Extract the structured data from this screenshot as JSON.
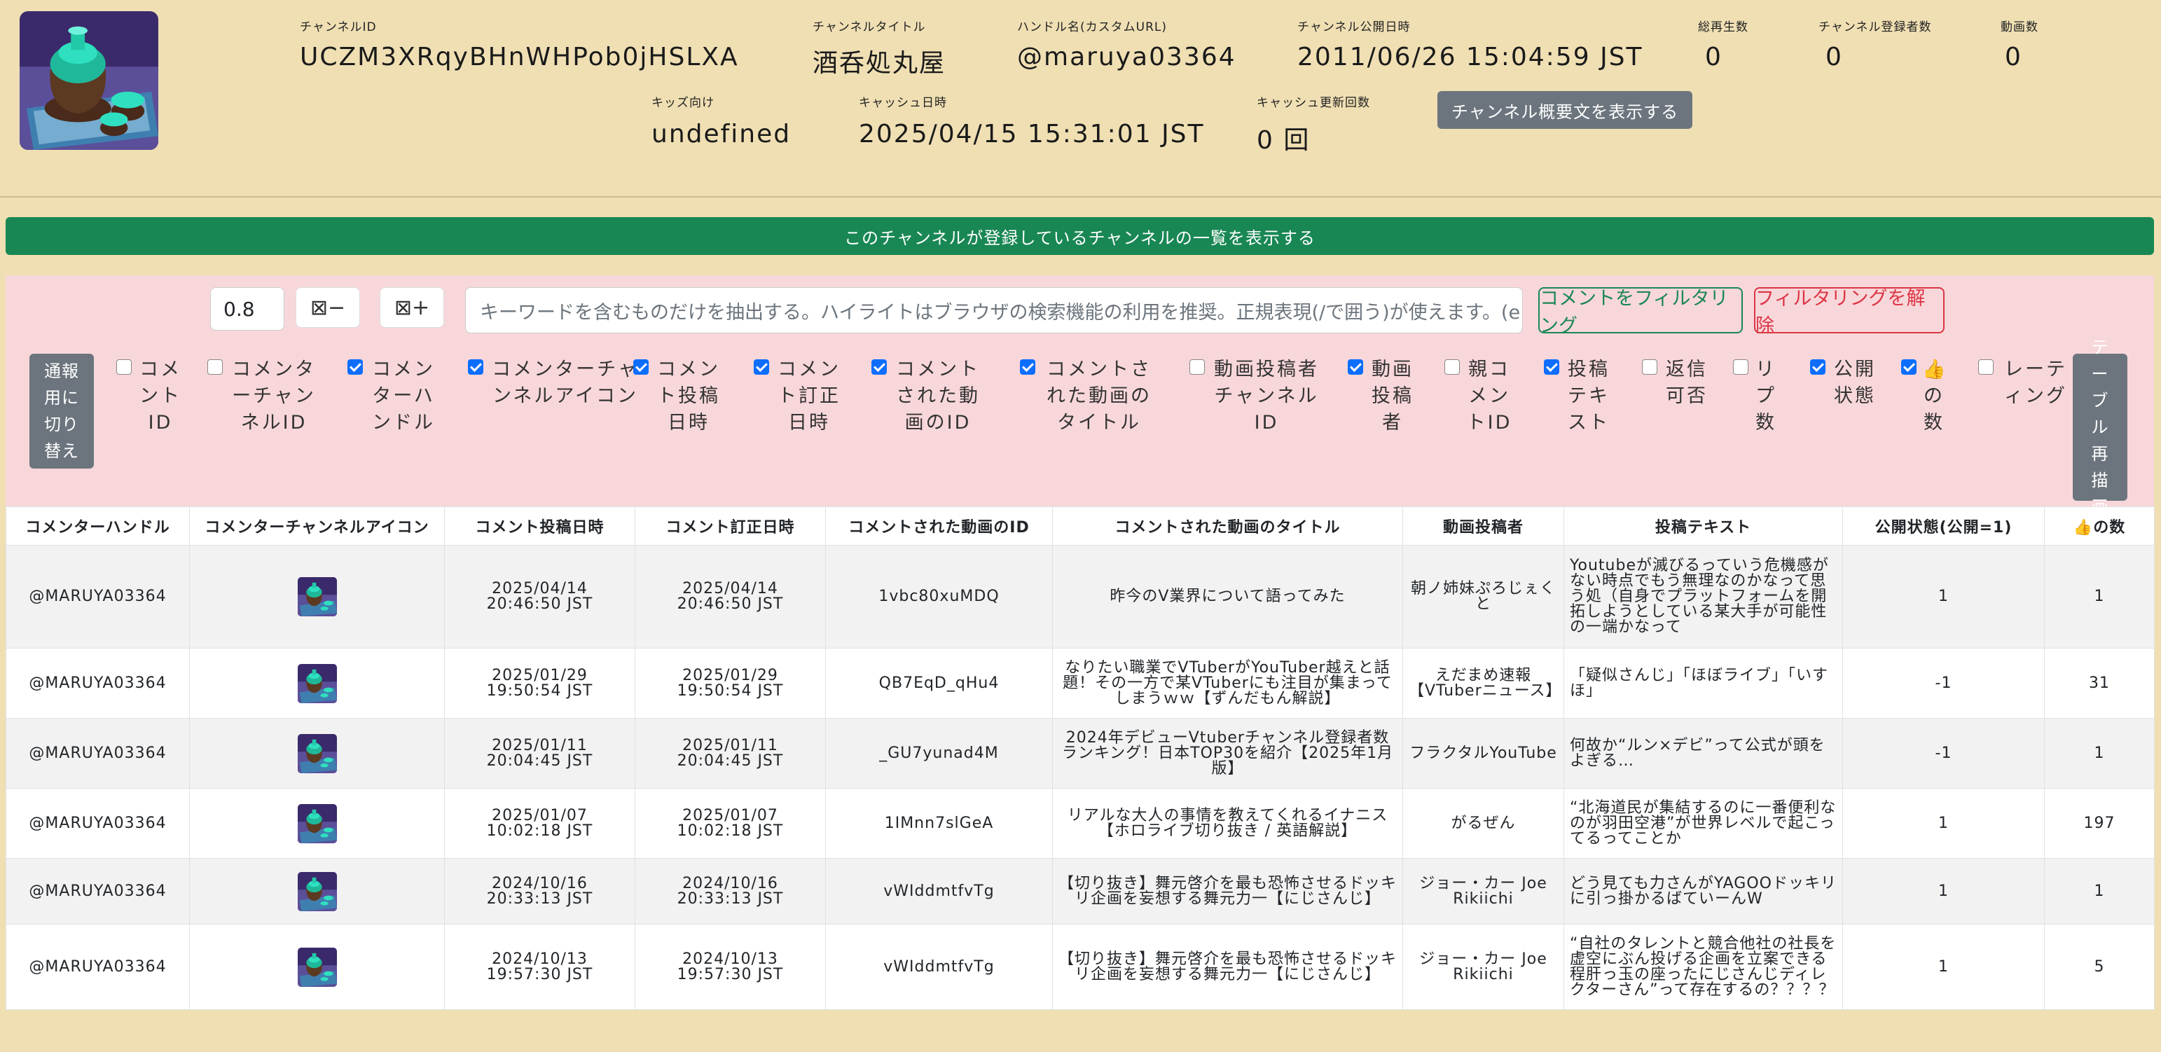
{
  "header": {
    "channel_id_label": "チャンネルID",
    "channel_id": "UCZM3XRqyBHnWHPob0jHSLXA",
    "channel_title_label": "チャンネルタイトル",
    "channel_title": "酒呑処丸屋",
    "handle_label": "ハンドル名(カスタムURL)",
    "handle": "@maruya03364",
    "published_label": "チャンネル公開日時",
    "published": "2011/06/26 15:04:59 JST",
    "total_views_label": "総再生数",
    "total_views": "0",
    "subscribers_label": "チャンネル登録者数",
    "subscribers": "0",
    "videos_label": "動画数",
    "videos": "0",
    "kids_label": "キッズ向け",
    "kids": "undefined",
    "cache_date_label": "キャッシュ日時",
    "cache_date": "2025/04/15 15:31:01 JST",
    "cache_count_label": "キャッシュ更新回数",
    "cache_count": "0 回",
    "show_desc_button": "チャンネル概要文を表示する"
  },
  "subscriptions_button": "このチャンネルが登録しているチャンネルの一覧を表示する",
  "filter": {
    "threshold_value": "0.8",
    "minus_label": "⊠−",
    "plus_label": "⊠+",
    "keyword_placeholder": "キーワードを含むものだけを抽出する。ハイライトはブラウザの検索機能の利用を推奨。正規表現(/で囲う)が使えます。(e.g. /(BC|AD",
    "filter_button": "コメントをフィルタリング",
    "clear_button": "フィルタリングを解除",
    "mode_button": "通報用に切り替え",
    "redraw_button": "テーブル再描画",
    "columns": [
      {
        "label": "コメントID",
        "checked": false
      },
      {
        "label": "コメンターチャンネルID",
        "checked": false
      },
      {
        "label": "コメンターハンドル",
        "checked": true
      },
      {
        "label": "コメンターチャンネルアイコン",
        "checked": true
      },
      {
        "label": "コメント投稿日時",
        "checked": true
      },
      {
        "label": "コメント訂正日時",
        "checked": true
      },
      {
        "label": "コメントされた動画のID",
        "checked": true
      },
      {
        "label": "コメントされた動画のタイトル",
        "checked": true
      },
      {
        "label": "動画投稿者チャンネルID",
        "checked": false
      },
      {
        "label": "動画投稿者",
        "checked": true
      },
      {
        "label": "親コメントID",
        "checked": false
      },
      {
        "label": "投稿テキスト",
        "checked": true
      },
      {
        "label": "返信可否",
        "checked": false
      },
      {
        "label": "リプ数",
        "checked": false
      },
      {
        "label": "公開状態",
        "checked": true
      },
      {
        "label": "👍の数",
        "checked": true
      },
      {
        "label": "レーティング",
        "checked": false
      }
    ]
  },
  "table": {
    "headers": [
      "コメンターハンドル",
      "コメンターチャンネルアイコン",
      "コメント投稿日時",
      "コメント訂正日時",
      "コメントされた動画のID",
      "コメントされた動画のタイトル",
      "動画投稿者",
      "投稿テキスト",
      "公開状態(公開=1)",
      "👍の数"
    ],
    "rows": [
      {
        "handle": "@MARUYA03364",
        "posted": "2025/04/14\n20:46:50 JST",
        "edited": "2025/04/14\n20:46:50 JST",
        "video_id": "1vbc80xuMDQ",
        "video_title": "昨今のV業界について語ってみた",
        "uploader": "朝ノ姉妹ぷろじぇくと",
        "text": "Youtubeが滅びるっていう危機感がない時点でもう無理なのかなって思う処（自身でプラットフォームを開拓しようとしている某大手が可能性の一端かなって",
        "status": "1",
        "likes": "1"
      },
      {
        "handle": "@MARUYA03364",
        "posted": "2025/01/29\n19:50:54 JST",
        "edited": "2025/01/29\n19:50:54 JST",
        "video_id": "QB7EqD_qHu4",
        "video_title": "なりたい職業でVTuberがYouTuber越えと話題！その一方で某VTuberにも注目が集まってしまうｗｗ【ずんだもん解説】",
        "uploader": "えだまめ速報【VTuberニュース】",
        "text": "「疑似さんじ」「ほぼライブ」「いすほ」",
        "status": "-1",
        "likes": "31"
      },
      {
        "handle": "@MARUYA03364",
        "posted": "2025/01/11\n20:04:45 JST",
        "edited": "2025/01/11\n20:04:45 JST",
        "video_id": "_GU7yunad4M",
        "video_title": "2024年デビューVtuberチャンネル登録者数ランキング！日本TOP30を紹介【2025年1月版】",
        "uploader": "フラクタルYouTube",
        "text": "何故か“ルン×デビ”って公式が頭をよぎる…",
        "status": "-1",
        "likes": "1"
      },
      {
        "handle": "@MARUYA03364",
        "posted": "2025/01/07\n10:02:18 JST",
        "edited": "2025/01/07\n10:02:18 JST",
        "video_id": "1IMnn7slGeA",
        "video_title": "リアルな大人の事情を教えてくれるイナニス【ホロライブ切り抜き / 英語解説】",
        "uploader": "がるぜん",
        "text": "“北海道民が集結するのに一番便利なのが羽田空港”が世界レベルで起こってるってことか",
        "status": "1",
        "likes": "197"
      },
      {
        "handle": "@MARUYA03364",
        "posted": "2024/10/16\n20:33:13 JST",
        "edited": "2024/10/16\n20:33:13 JST",
        "video_id": "vWIddmtfvTg",
        "video_title": "【切り抜き】舞元啓介を最も恐怖させるドッキリ企画を妄想する舞元力一【にじさんじ】",
        "uploader": "ジョー・カー Joe Rikiichi",
        "text": "どう見ても力さんがYAGOOドッキリに引っ掛かるばていーんW",
        "status": "1",
        "likes": "1"
      },
      {
        "handle": "@MARUYA03364",
        "posted": "2024/10/13\n19:57:30 JST",
        "edited": "2024/10/13\n19:57:30 JST",
        "video_id": "vWIddmtfvTg",
        "video_title": "【切り抜き】舞元啓介を最も恐怖させるドッキリ企画を妄想する舞元力一【にじさんじ】",
        "uploader": "ジョー・カー Joe Rikiichi",
        "text": "“自社のタレントと競合他社の社長を虚空にぶん投げる企画を立案できる程肝っ玉の座ったにじさんじディレクターさん”って存在するの？？？？",
        "status": "1",
        "likes": "5"
      }
    ]
  }
}
